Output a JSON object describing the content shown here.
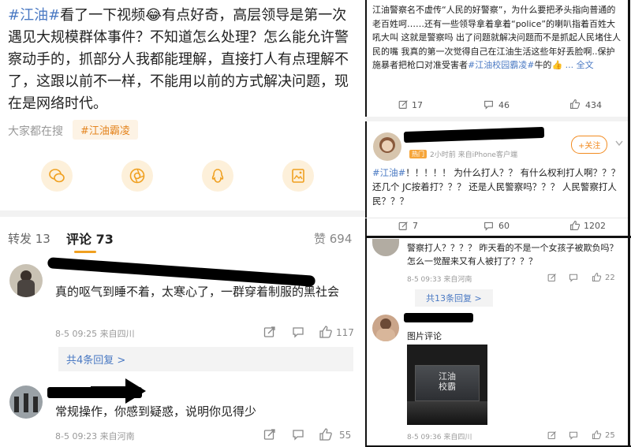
{
  "left": {
    "post": {
      "tag": "#江油#",
      "text_1": "看了一下视频",
      "emoji": "😂",
      "text_2": "有点好奇，高层领导是第一次遇见大规模群体事件？不知道怎么处理？怎么能允许警察动手的，抓部分人我都能理解，直接打人有点理解不了，这跟以前不一样，不能用以前的方式解决问题，现在是网络时代。"
    },
    "trending": {
      "label": "大家都在搜",
      "tag": "#江油霸凌"
    },
    "share_icons": [
      "wechat-icon",
      "moments-icon",
      "qq-icon",
      "save-image-icon"
    ],
    "tabs": {
      "repost": "转发 13",
      "comment_label": "评论",
      "comment_count": "73",
      "like": "赞 694"
    },
    "comments": [
      {
        "text": "真的呕气到睡不着，太寒心了，一群穿着制服的黑社会",
        "meta": "8-5 09:25 来自四川",
        "reply": "共4条回复 >",
        "likes": "117"
      },
      {
        "text": "常规操作，你感到疑惑，说明你见得少",
        "meta": "8-5 09:23 来自河南",
        "likes": "55"
      }
    ]
  },
  "top_right": {
    "text_1": "江油警察名不虚传“人民的好警察”，为什么要把矛头指向普通的老百姓呵……还有一些领导拿着拿着“police”的喇叭指着百姓大吼大叫 这就是警察吗 出了问题就解决问题而不是抓起人民堵住人民的嘴 我真的第一次觉得自己在江油生活这些年好丢脸啊..保护施暴者把枪口对准受害者",
    "tag": "#江油校园霸凌#",
    "text_2": "牛的",
    "emoji": "👍",
    "more": "... 全文",
    "actions": {
      "repost": "17",
      "comment": "46",
      "like": "434"
    },
    "comment": {
      "follow": "+关注",
      "hot_badge": "热门",
      "time": "2小时前 来自iPhone客户端",
      "tag": "#江油#",
      "text": "！！！！！ 为什么打人？？ 有什么权利打人啊？？？ 还几个 JC按着打？？？ 还是人民警察吗？？？ 人民警察打人民？？？",
      "actions": {
        "repost": "7",
        "comment": "60",
        "like": "1202"
      }
    }
  },
  "bottom_right": {
    "comment_1": {
      "text": "警察打人？？？？ 昨天看的不是一个女孩子被欺负吗？怎么一觉醒来又有人被打了？？？",
      "meta": "8-5 09:33 来自河南",
      "likes": "22",
      "reply": "共13条回复 >"
    },
    "comment_2": {
      "label": "图片评论",
      "image_text": "江油\n校霸",
      "meta": "8-5 09:36 来自四川",
      "likes": "25"
    }
  }
}
